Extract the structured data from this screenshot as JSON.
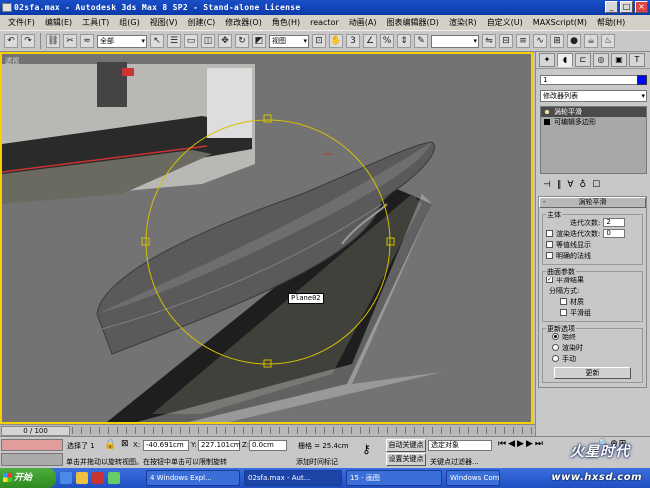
{
  "window": {
    "title": "02sfa.max  - Autodesk 3ds Max 8 SP2  - Stand-alone License",
    "minimize": "_",
    "maximize": "□",
    "close": "×"
  },
  "menu": [
    "文件(F)",
    "编辑(E)",
    "工具(T)",
    "组(G)",
    "视图(V)",
    "创建(C)",
    "修改器(O)",
    "角色(H)",
    "reactor",
    "动画(A)",
    "图表编辑器(D)",
    "渲染(R)",
    "自定义(U)",
    "MAXScript(M)",
    "帮助(H)"
  ],
  "toolbar": {
    "selection_filter": "全部",
    "ref_coord": "视图"
  },
  "viewport": {
    "label": "透视",
    "selected_object_label": "Plane02",
    "accent_color": "#f5d000",
    "gizmo_color": "#d4c000"
  },
  "command_panel": {
    "object_name": "1",
    "object_color": "#0000ff",
    "modifier_list": "修改器列表",
    "stack": [
      {
        "label": "涡轮平滑",
        "selected": true,
        "icon": "lightbulb-icon"
      },
      {
        "label": "可编辑多边形",
        "selected": false,
        "icon": "box-icon"
      }
    ],
    "rollout_title": "涡轮平滑",
    "main_group": {
      "title": "主体",
      "iterations_label": "迭代次数:",
      "iterations_value": "2",
      "render_iters_label": "渲染迭代次数:",
      "render_iters_value": "0",
      "isoline_label": "等值线显示",
      "explicit_normals_label": "明确的法线"
    },
    "surface_group": {
      "title": "曲面参数",
      "smooth_result_label": "平滑结果",
      "separate_label": "分隔方式:",
      "materials_label": "材质",
      "smoothing_groups_label": "平滑组"
    },
    "update_group": {
      "title": "更新选项",
      "always_label": "始终",
      "render_label": "渲染时",
      "manual_label": "手动",
      "update_button": "更新"
    }
  },
  "timeline": {
    "slider_label": "0 / 100"
  },
  "status": {
    "selected": "选择了 1",
    "x_label": "X:",
    "x_value": "-40.691cm",
    "y_label": "Y:",
    "y_value": "227.101cm",
    "z_label": "Z:",
    "z_value": "0.0cm",
    "grid": "栅格 = 25.4cm",
    "prompt": "单击并拖动以旋转视图。在按钮中单击可以限制旋转",
    "add_time_tag": "添加时间标记",
    "auto_key": "自动关键点",
    "set_key": "设置关键点",
    "selected_object": "选定对象",
    "key_filters": "关键点过滤器..."
  },
  "taskbar": {
    "start": "开始",
    "tasks": [
      "4 Windows Expl...",
      "02sfa.max - Aut...",
      "15 - 画图",
      "Windows Comm..."
    ]
  },
  "watermark": {
    "line1": "火星时代",
    "line2": "www.hxsd.com"
  }
}
